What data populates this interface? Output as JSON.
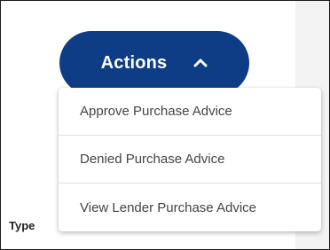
{
  "actions_button": {
    "label": "Actions",
    "icon": "chevron-up-icon",
    "color": "#0f3d85"
  },
  "side_label": "Type",
  "menu": {
    "items": [
      "Approve Purchase Advice",
      "Denied Purchase Advice",
      "View Lender Purchase Advice"
    ]
  }
}
